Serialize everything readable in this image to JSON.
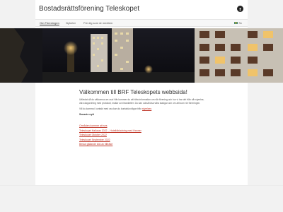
{
  "header": {
    "title": "Bostadsrättsförening Teleskopet",
    "facebook_icon": "facebook-icon"
  },
  "nav": {
    "items": [
      {
        "label": "Om Föreningen",
        "active": true
      },
      {
        "label": "Nyheter",
        "active": false
      },
      {
        "label": "För dig som är medlem",
        "active": false
      }
    ],
    "language": "Sv"
  },
  "main": {
    "heading": "Välkommen till BRF Teleskopets webbsida!",
    "intro": "Utfärdat då du välkomna om oss! Här kommer du att hitta information om vår förening och hur vi har det från vår styrelse, våra dagordning med protokoll, mallar och blanketter. Du kan också läsa våra stadgar och om allt som rör föreningen.",
    "contact_prefix": "Vill du komma i kontakt med oss kan du kontakta någon från ",
    "contact_link": "styrelsen",
    "contact_suffix": ".",
    "recent_heading": "Senaste nytt",
    "links": [
      "Områden kommer att ses",
      "Teleskopet Hallunar 2022 – Hotelldbladning med Hanner",
      "Teleskopet Oktober 2022",
      "Teleskopet September 2022",
      "Beslut gällande kök av tillträde"
    ]
  },
  "colors": {
    "link": "#c0392b",
    "background": "#f2f2f2",
    "page": "#ffffff"
  }
}
